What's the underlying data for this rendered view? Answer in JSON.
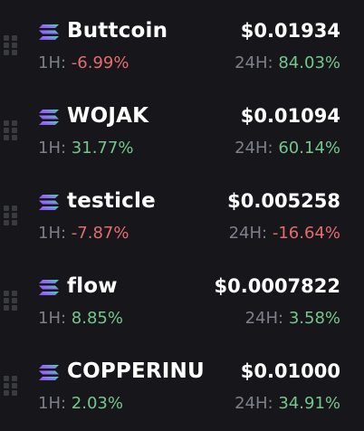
{
  "labels": {
    "h1": "1H:",
    "h24": "24H:"
  },
  "colors": {
    "background": "#17171b",
    "positive": "#74c78b",
    "negative": "#e46c6c",
    "muted": "#7d7f8a"
  },
  "icons": {
    "token": "solana-logo-icon",
    "handle": "drag-handle-icon"
  },
  "tokens": [
    {
      "name": "Buttcoin",
      "price": "$0.01934",
      "change_1h": "-6.99%",
      "change_1h_dir": "neg",
      "change_24h": "84.03%",
      "change_24h_dir": "pos"
    },
    {
      "name": "WOJAK",
      "price": "$0.01094",
      "change_1h": "31.77%",
      "change_1h_dir": "pos",
      "change_24h": "60.14%",
      "change_24h_dir": "pos"
    },
    {
      "name": "testicle",
      "price": "$0.005258",
      "change_1h": "-7.87%",
      "change_1h_dir": "neg",
      "change_24h": "-16.64%",
      "change_24h_dir": "neg"
    },
    {
      "name": "flow",
      "price": "$0.0007822",
      "change_1h": "8.85%",
      "change_1h_dir": "pos",
      "change_24h": "3.58%",
      "change_24h_dir": "pos"
    },
    {
      "name": "COPPERINU",
      "price": "$0.01000",
      "change_1h": "2.03%",
      "change_1h_dir": "pos",
      "change_24h": "34.91%",
      "change_24h_dir": "pos"
    }
  ]
}
